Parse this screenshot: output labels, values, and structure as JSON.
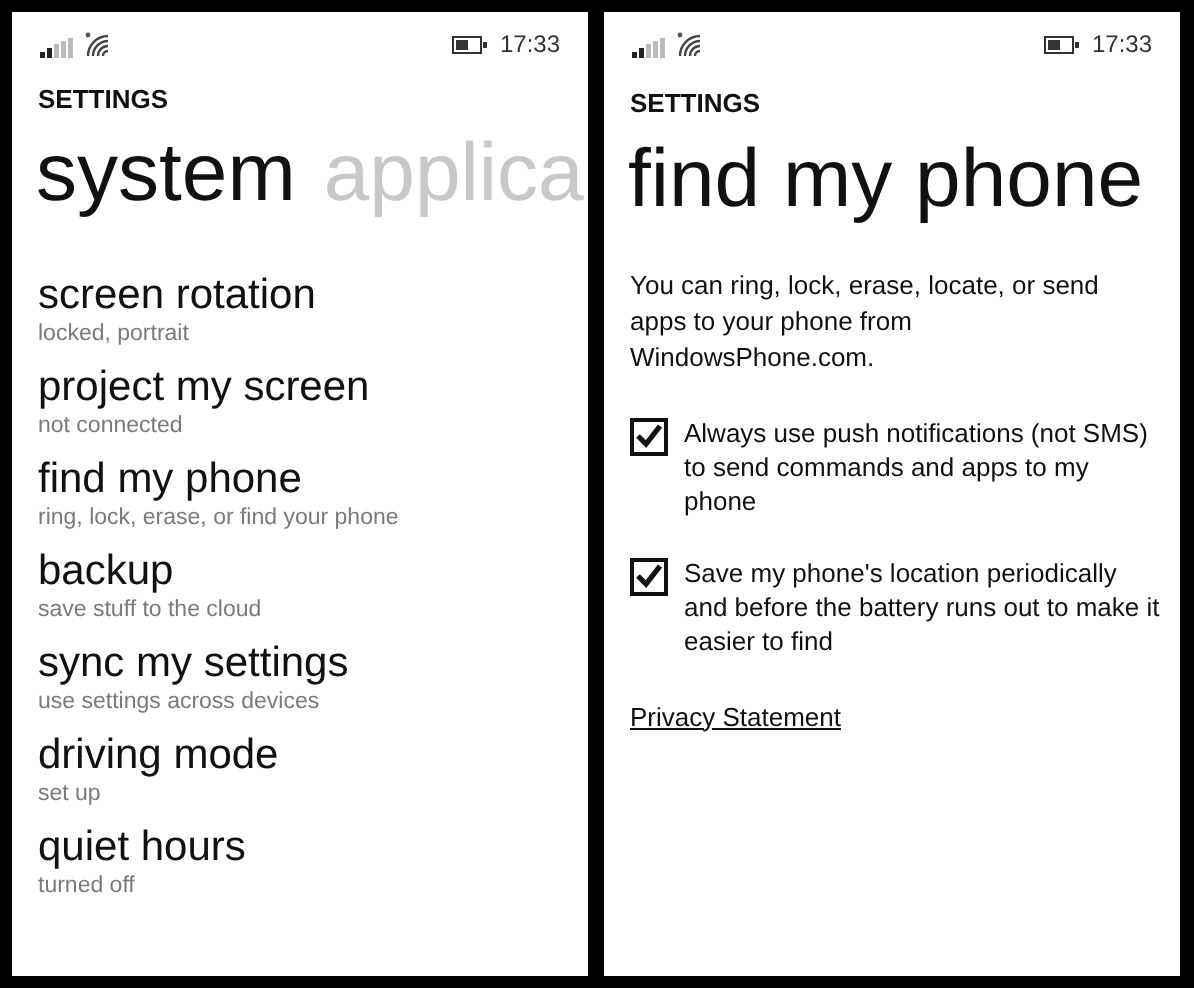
{
  "system_screen": {
    "status_bar": {
      "time": "17:33"
    },
    "header": "SETTINGS",
    "pivots": [
      {
        "label": "system",
        "selected": true
      },
      {
        "label": "applica",
        "selected": false
      }
    ],
    "items": [
      {
        "title": "screen rotation",
        "subtitle": "locked, portrait"
      },
      {
        "title": "project my screen",
        "subtitle": "not connected"
      },
      {
        "title": "find my phone",
        "subtitle": "ring, lock, erase, or find your phone"
      },
      {
        "title": "backup",
        "subtitle": "save stuff to the cloud"
      },
      {
        "title": "sync my settings",
        "subtitle": "use settings across devices"
      },
      {
        "title": "driving mode",
        "subtitle": "set up"
      },
      {
        "title": "quiet hours",
        "subtitle": "turned off"
      }
    ]
  },
  "find_phone_screen": {
    "status_bar": {
      "time": "17:33"
    },
    "header": "SETTINGS",
    "title": "find my phone",
    "description": "You can ring, lock, erase, locate, or send apps to your phone from WindowsPhone.com.",
    "options": [
      {
        "label": "Always use push notifications (not SMS) to send commands and apps to my phone",
        "checked": true
      },
      {
        "label": "Save my phone's location periodically and before the battery runs out to make it easier to find",
        "checked": true
      }
    ],
    "link": "Privacy Statement"
  }
}
